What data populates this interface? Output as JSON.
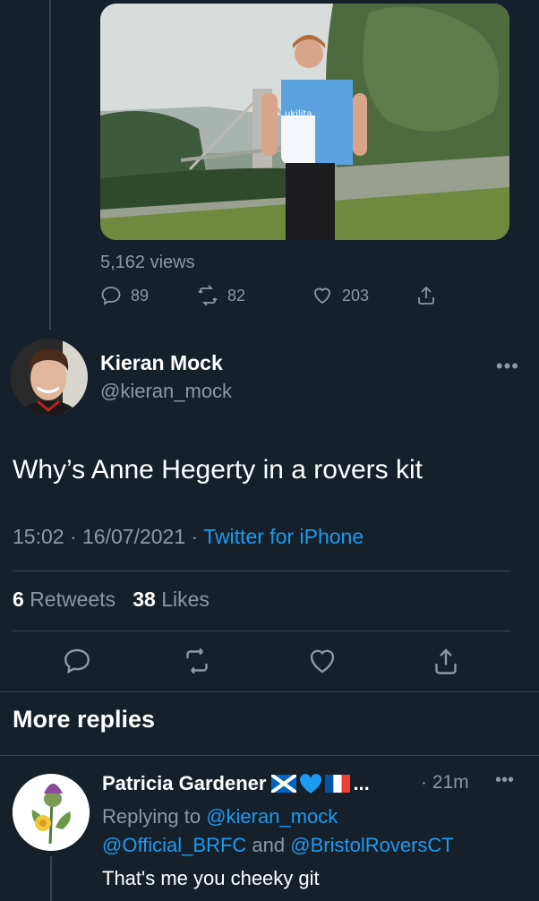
{
  "prior_tweet": {
    "media_kit_text": "ukilita",
    "views": "5,162 views",
    "replies": "89",
    "retweets": "82",
    "likes": "203"
  },
  "main_tweet": {
    "author_name": "Kieran Mock",
    "author_handle": "@kieran_mock",
    "more": "•••",
    "text": "Why’s Anne Hegerty in a rovers kit",
    "time": "15:02",
    "date": "16/07/2021",
    "source": "Twitter for iPhone",
    "retweet_count": "6",
    "retweet_label": "Retweets",
    "like_count": "38",
    "like_label": "Likes"
  },
  "more_replies": {
    "title": "More replies"
  },
  "reply": {
    "name": "Patricia Gardener",
    "ellipsis": "...",
    "time": "21m",
    "more": "•••",
    "replying_to_label": "Replying to",
    "mention_1": "@kieran_mock",
    "mention_2": "@Official_BRFC",
    "and_label": "and",
    "mention_3": "@BristolRoversCT",
    "text": "That's me you cheeky git"
  },
  "colors": {
    "background": "#15202b",
    "secondary_text": "#8b98a5",
    "link": "#1d9bf0",
    "divider": "#38444d"
  }
}
